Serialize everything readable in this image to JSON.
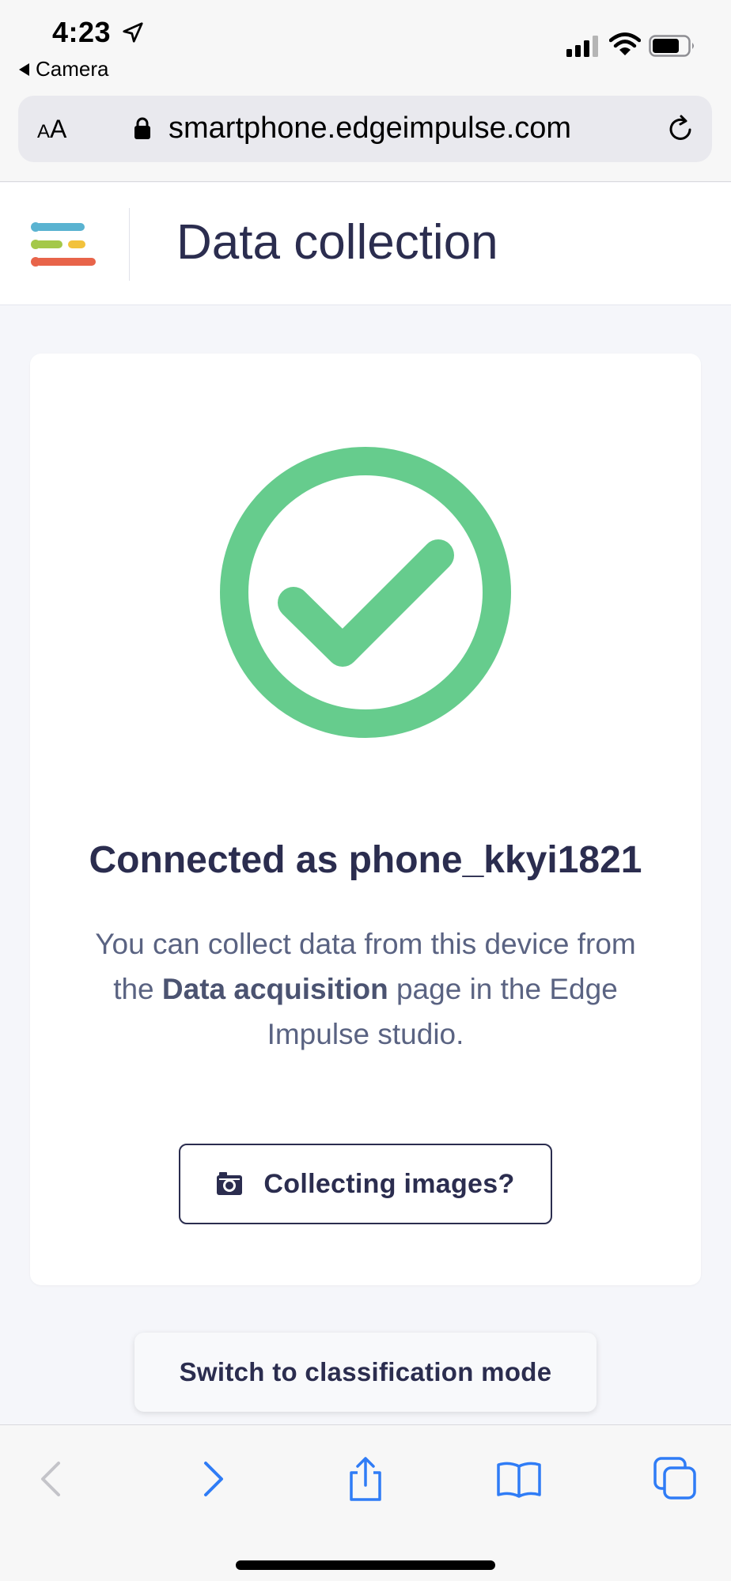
{
  "status_bar": {
    "time": "4:23",
    "back_app": "Camera"
  },
  "browser": {
    "text_size_label_small": "A",
    "text_size_label_large": "A",
    "url": "smartphone.edgeimpulse.com"
  },
  "header": {
    "title": "Data collection"
  },
  "card": {
    "connected_title": "Connected as phone_kkyi1821",
    "desc_part1": "You can collect data from this device from the ",
    "desc_bold": "Data acquisition",
    "desc_part2": " page in the Edge Impulse studio.",
    "collect_button": "Collecting images?"
  },
  "switch_button": "Switch to classification mode",
  "colors": {
    "success_green": "#66cc8d",
    "text_dark": "#2b2d4f",
    "ios_blue": "#2f7cf6"
  },
  "toolbar": {
    "icons": [
      "back-icon",
      "forward-icon",
      "share-icon",
      "bookmarks-icon",
      "tabs-icon"
    ]
  }
}
